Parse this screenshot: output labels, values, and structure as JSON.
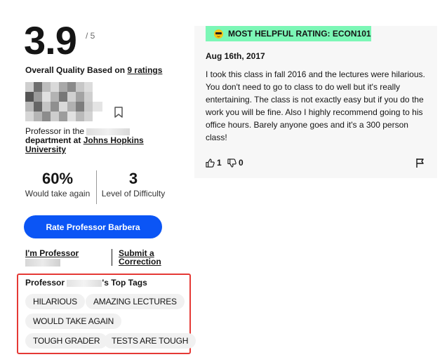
{
  "summary": {
    "rating": "3.9",
    "rating_denominator": "/ 5",
    "quality_prefix": "Overall Quality Based on ",
    "ratings_link": "9 ratings"
  },
  "professor": {
    "dept_prefix": "Professor in the",
    "dept_mid": "department at",
    "school_link": "Johns Hopkins University"
  },
  "stats": {
    "take_again_value": "60%",
    "take_again_label": "Would take again",
    "difficulty_value": "3",
    "difficulty_label": "Level of Difficulty"
  },
  "actions": {
    "rate_button": "Rate Professor Barbera",
    "im_professor": "I'm Professor",
    "submit_correction": "Submit a Correction"
  },
  "tags": {
    "title_prefix": "Professor",
    "title_suffix": "'s Top Tags",
    "items": [
      "HILARIOUS",
      "AMAZING LECTURES",
      "WOULD TAKE AGAIN",
      "TOUGH GRADER",
      "TESTS ARE TOUGH"
    ]
  },
  "review": {
    "badge": "MOST HELPFUL RATING: ECON101",
    "badge_icon": "sunglasses-emoji-icon",
    "date": "Aug 16th, 2017",
    "text": "I took this class in fall 2016 and the lectures were hilarious. You don't need to go to class to do well but it's really entertaining. The class is not exactly easy but if you do the work you will be fine. Also I highly recommend going to his office hours. Barely anyone goes and it's a 300 person class!",
    "thumbs_up": "1",
    "thumbs_down": "0"
  },
  "colors": {
    "accent_button": "#0b55f5",
    "badge_bg": "#7cf7b6",
    "highlight_border": "#e53935",
    "tag_bg": "#f1f1f1",
    "card_bg": "#f7f7f7"
  }
}
